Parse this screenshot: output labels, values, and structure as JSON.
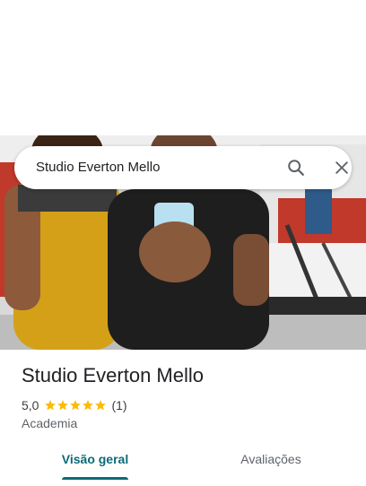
{
  "search": {
    "value": "Studio Everton Mello"
  },
  "place": {
    "name": "Studio Everton Mello",
    "rating": "5,0",
    "stars": 5,
    "review_count": "(1)",
    "category": "Academia"
  },
  "tabs": [
    {
      "label": "Visão geral",
      "active": true
    },
    {
      "label": "Avaliações",
      "active": false
    }
  ],
  "icons": {
    "search": "search-icon",
    "close": "close-icon",
    "star": "star-icon"
  },
  "colors": {
    "accent": "#0b6b77",
    "star": "#fbbc04",
    "text_primary": "#202124",
    "text_secondary": "#5f6368"
  }
}
